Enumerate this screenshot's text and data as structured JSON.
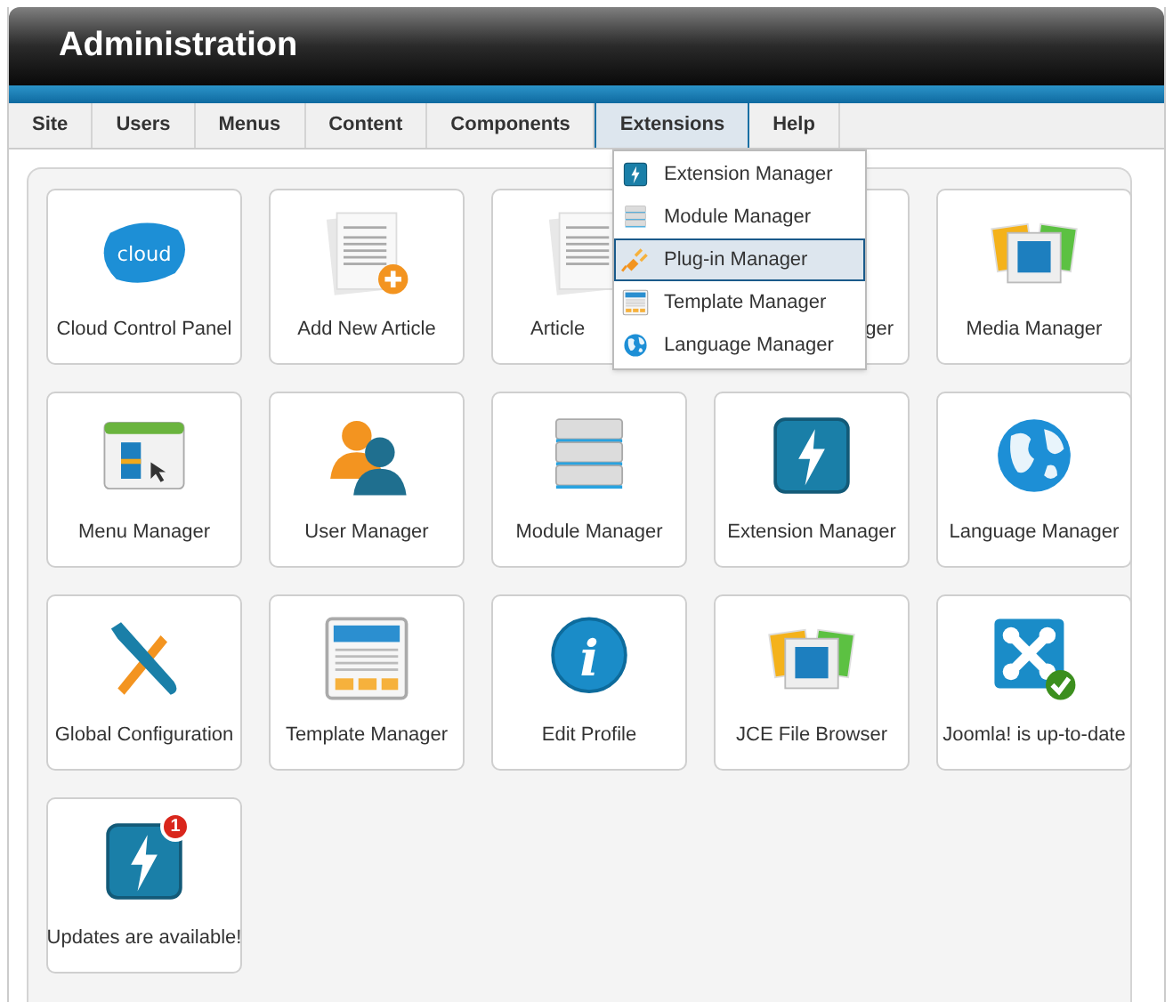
{
  "header": {
    "title": "Administration"
  },
  "menu": [
    {
      "label": "Site",
      "selected": false
    },
    {
      "label": "Users",
      "selected": false
    },
    {
      "label": "Menus",
      "selected": false
    },
    {
      "label": "Content",
      "selected": false
    },
    {
      "label": "Components",
      "selected": false
    },
    {
      "label": "Extensions",
      "selected": true
    },
    {
      "label": "Help",
      "selected": false
    }
  ],
  "dropdown": [
    {
      "label": "Extension Manager",
      "kind": "bolt",
      "selected": false
    },
    {
      "label": "Module Manager",
      "kind": "stack",
      "selected": false
    },
    {
      "label": "Plug-in Manager",
      "kind": "plug",
      "selected": true
    },
    {
      "label": "Template Manager",
      "kind": "template",
      "selected": false
    },
    {
      "label": "Language Manager",
      "kind": "globe",
      "selected": false
    }
  ],
  "tiles": [
    {
      "label": "Cloud Control Panel",
      "kind": "cloud",
      "icon_text": "cloud"
    },
    {
      "label": "Add New Article",
      "kind": "newarticle"
    },
    {
      "label": "Article",
      "kind": "article"
    },
    {
      "label": "ger",
      "kind": "covered"
    },
    {
      "label": "Media Manager",
      "kind": "photos"
    },
    {
      "label": "Menu Manager",
      "kind": "window"
    },
    {
      "label": "User Manager",
      "kind": "users"
    },
    {
      "label": "Module Manager",
      "kind": "stack"
    },
    {
      "label": "Extension Manager",
      "kind": "bolt"
    },
    {
      "label": "Language Manager",
      "kind": "globe"
    },
    {
      "label": "Global Configuration",
      "kind": "tools"
    },
    {
      "label": "Template Manager",
      "kind": "template"
    },
    {
      "label": "Edit Profile",
      "kind": "info",
      "icon_text": "i"
    },
    {
      "label": "JCE File Browser",
      "kind": "photos"
    },
    {
      "label": "Joomla! is up-to-date",
      "kind": "knot"
    },
    {
      "label": "Updates are available!",
      "kind": "bolt",
      "badge": "1"
    }
  ]
}
